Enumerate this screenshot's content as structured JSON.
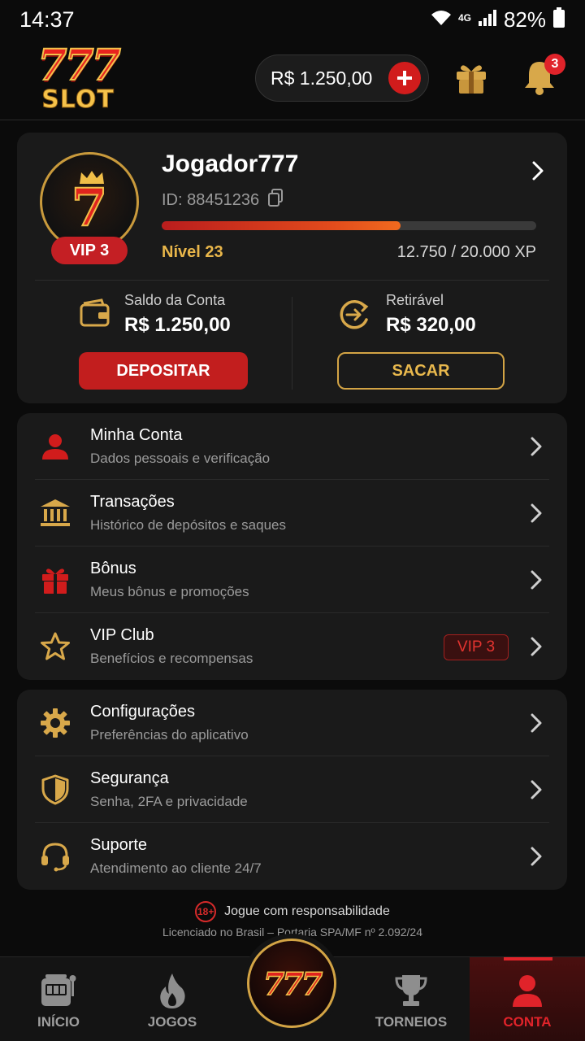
{
  "status_bar": {
    "time": "14:37",
    "network": "4G",
    "battery": "82%"
  },
  "header": {
    "logo_top": "777",
    "logo_bottom": "SLOT",
    "balance": "R$ 1.250,00",
    "notifications_count": "3"
  },
  "profile": {
    "username": "Jogador777",
    "id_label": "ID: 88451236",
    "vip_badge": "VIP 3",
    "avatar_glyph": "7",
    "level_label": "Nível 23",
    "xp_text": "12.750 / 20.000 XP",
    "xp_fraction": 0.6375,
    "account_balance_label": "Saldo da Conta",
    "account_balance_value": "R$ 1.250,00",
    "withdrawable_label": "Retirável",
    "withdrawable_value": "R$ 320,00",
    "deposit_button": "DEPOSITAR",
    "withdraw_button": "SACAR"
  },
  "menu_primary": [
    {
      "title": "Minha Conta",
      "subtitle": "Dados pessoais e verificação",
      "icon": "user-icon"
    },
    {
      "title": "Transações",
      "subtitle": "Histórico de depósitos e saques",
      "icon": "bank-icon"
    },
    {
      "title": "Bônus",
      "subtitle": "Meus bônus e promoções",
      "icon": "gift-icon"
    },
    {
      "title": "VIP Club",
      "subtitle": "Benefícios e recompensas",
      "icon": "star-icon",
      "tag": "VIP 3"
    }
  ],
  "menu_secondary": [
    {
      "title": "Configurações",
      "subtitle": "Preferências do aplicativo",
      "icon": "gear-icon"
    },
    {
      "title": "Segurança",
      "subtitle": "Senha, 2FA e privacidade",
      "icon": "shield-icon"
    },
    {
      "title": "Suporte",
      "subtitle": "Atendimento ao cliente 24/7",
      "icon": "headset-icon"
    }
  ],
  "footer": {
    "age_badge": "18+",
    "responsible_text": "Jogue com responsabilidade",
    "license_text": "Licenciado no Brasil – Portaria SPA/MF nº 2.092/24"
  },
  "bottom_nav": {
    "items": [
      {
        "label": "INÍCIO",
        "icon": "slot-machine-icon"
      },
      {
        "label": "JOGOS",
        "icon": "flame-icon"
      },
      {
        "label": "TORNEIOS",
        "icon": "trophy-icon"
      },
      {
        "label": "CONTA",
        "icon": "user-icon",
        "active": true
      }
    ],
    "center_label": "777"
  },
  "colors": {
    "accent_red": "#c21e1e",
    "gold": "#d3a445",
    "background": "#0b0b0b",
    "card": "#1a1a1a"
  }
}
